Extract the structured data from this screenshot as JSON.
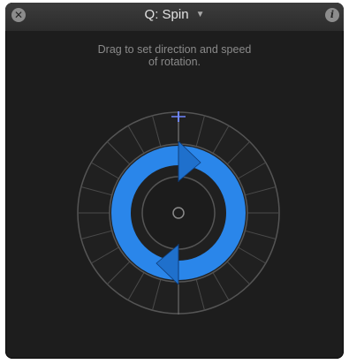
{
  "hud": {
    "title": "Q: Spin",
    "title_caret": "▼",
    "close_glyph": "✕",
    "info_glyph": "i",
    "instruction_line1": "Drag to set direction and speed",
    "instruction_line2": "of rotation."
  },
  "dial": {
    "accent_color": "#2a86ea",
    "ring_color": "#555555",
    "indicator_color": "#6f86ff",
    "direction": "clockwise"
  }
}
